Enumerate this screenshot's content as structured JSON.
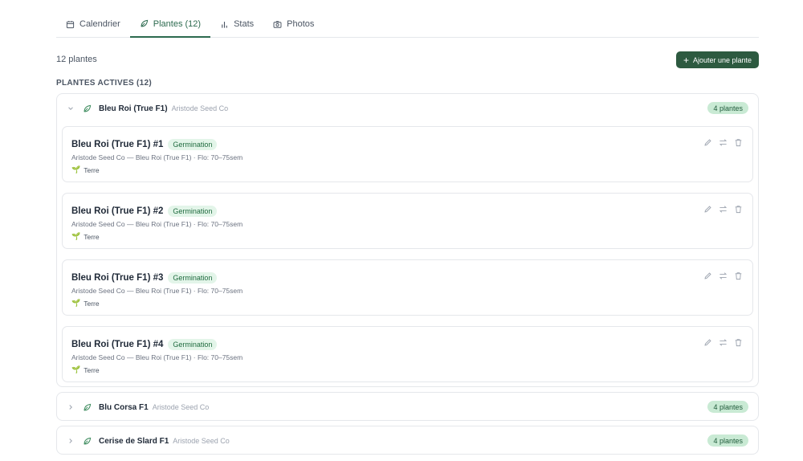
{
  "tabs": [
    {
      "label": "Calendrier",
      "icon": "calendar-icon"
    },
    {
      "label": "Plantes (12)",
      "icon": "leaf-icon",
      "active": true
    },
    {
      "label": "Stats",
      "icon": "bar-chart-icon"
    },
    {
      "label": "Photos",
      "icon": "camera-icon"
    }
  ],
  "summary": {
    "count": "12 plantes"
  },
  "add_button": {
    "label": "Ajouter une plante"
  },
  "section": {
    "title": "PLANTES ACTIVES (12)"
  },
  "groups": [
    {
      "name": "Bleu Roi (True F1)",
      "supplier": "Aristode Seed Co",
      "badge": "4 plantes",
      "expanded": true
    },
    {
      "name": "Blu Corsa F1",
      "supplier": "Aristode Seed Co",
      "badge": "4 plantes",
      "expanded": false
    },
    {
      "name": "Cerise de Slard F1",
      "supplier": "Aristode Seed Co",
      "badge": "4 plantes",
      "expanded": false
    }
  ],
  "cards": [
    {
      "name": "Bleu Roi (True F1) #1",
      "status": "Germination",
      "details": "Aristode Seed Co — Bleu Roi (True F1) · Flo: 70–75sem",
      "location": "Terre"
    },
    {
      "name": "Bleu Roi (True F1) #2",
      "status": "Germination",
      "details": "Aristode Seed Co — Bleu Roi (True F1) · Flo: 70–75sem",
      "location": "Terre"
    },
    {
      "name": "Bleu Roi (True F1) #3",
      "status": "Germination",
      "details": "Aristode Seed Co — Bleu Roi (True F1) · Flo: 70–75sem",
      "location": "Terre"
    },
    {
      "name": "Bleu Roi (True F1) #4",
      "status": "Germination",
      "details": "Aristode Seed Co — Bleu Roi (True F1) · Flo: 70–75sem",
      "location": "Terre"
    }
  ],
  "colors": {
    "accent": "#2d6a4f",
    "button": "#2d5a40",
    "badge_bg": "#e3f5e9",
    "pill_bg": "#c9ead4"
  }
}
